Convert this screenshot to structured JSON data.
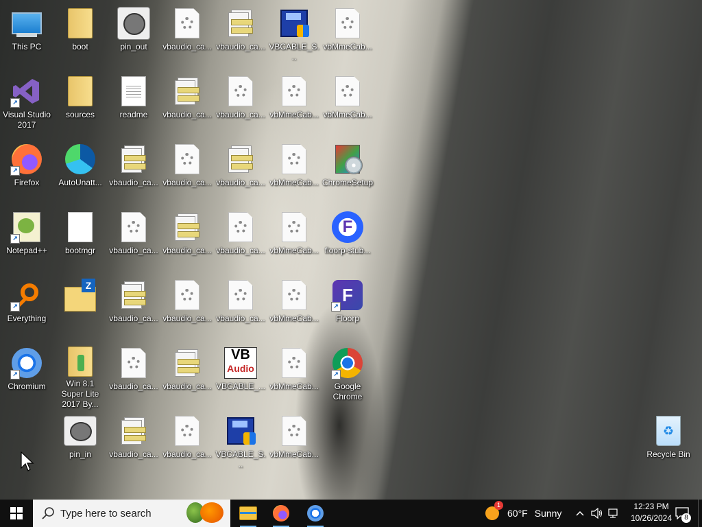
{
  "desktop_icons": [
    {
      "label": "This PC"
    },
    {
      "label": "boot"
    },
    {
      "label": "pin_out"
    },
    {
      "label": "vbaudio_ca..."
    },
    {
      "label": "vbaudio_ca..."
    },
    {
      "label": "VBCABLE_S..."
    },
    {
      "label": "vbMmeCab..."
    },
    {
      "label": "Visual Studio 2017"
    },
    {
      "label": "sources"
    },
    {
      "label": "readme"
    },
    {
      "label": "vbaudio_ca..."
    },
    {
      "label": "vbaudio_ca..."
    },
    {
      "label": "vbMmeCab..."
    },
    {
      "label": "vbMmeCab..."
    },
    {
      "label": "Firefox"
    },
    {
      "label": "AutoUnatt..."
    },
    {
      "label": "vbaudio_ca..."
    },
    {
      "label": "vbaudio_ca..."
    },
    {
      "label": "vbaudio_ca..."
    },
    {
      "label": "vbMmeCab..."
    },
    {
      "label": "ChromeSetup"
    },
    {
      "label": "Notepad++"
    },
    {
      "label": "bootmgr"
    },
    {
      "label": "vbaudio_ca..."
    },
    {
      "label": "vbaudio_ca..."
    },
    {
      "label": "vbaudio_ca..."
    },
    {
      "label": "vbMmeCab..."
    },
    {
      "label": "floorp-stub..."
    },
    {
      "label": "Everything"
    },
    {
      "label": ""
    },
    {
      "label": "vbaudio_ca..."
    },
    {
      "label": "vbaudio_ca..."
    },
    {
      "label": "vbaudio_ca..."
    },
    {
      "label": "vbMmeCab..."
    },
    {
      "label": "Floorp"
    },
    {
      "label": "Chromium"
    },
    {
      "label": "Win 8.1 Super Lite 2017 By..."
    },
    {
      "label": "vbaudio_ca..."
    },
    {
      "label": "vbaudio_ca..."
    },
    {
      "label": "VBCABLE_..."
    },
    {
      "label": "vbMmeCab..."
    },
    {
      "label": "Google Chrome"
    },
    {
      "label": "pin_in"
    },
    {
      "label": "vbaudio_ca..."
    },
    {
      "label": "vbaudio_ca..."
    },
    {
      "label": "VBCABLE_S..."
    },
    {
      "label": "vbMmeCab..."
    },
    {
      "label": "Recycle Bin"
    }
  ],
  "taskbar": {
    "search_placeholder": "Type here to search",
    "weather_temp": "60°F",
    "weather_condition": "Sunny",
    "weather_badge": "1",
    "clock_time": "12:23 PM",
    "clock_date": "10/26/2024",
    "notification_count": "8",
    "pinned": [
      "File Explorer",
      "Firefox",
      "Chromium"
    ]
  },
  "colors": {
    "taskbar_bg": "#101010",
    "search_bg": "#f3f3f3",
    "accent": "#76b9ed"
  }
}
